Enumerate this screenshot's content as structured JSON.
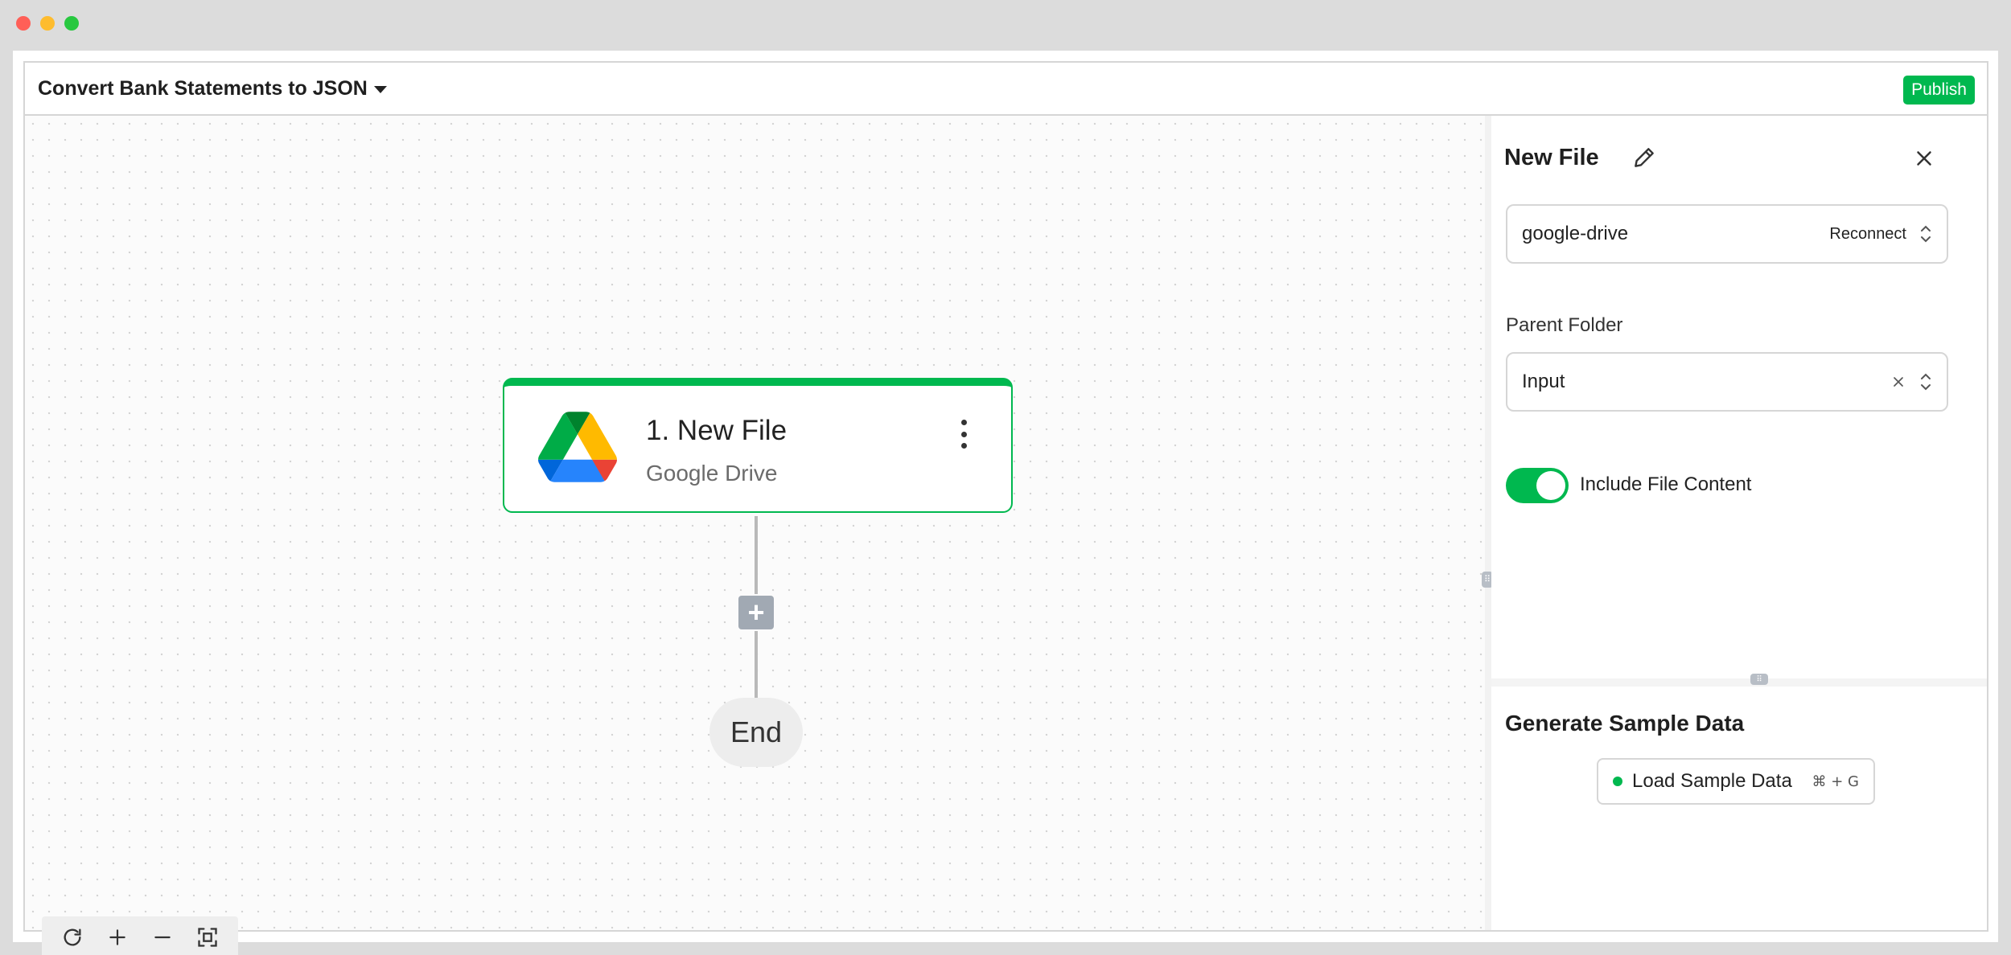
{
  "window": {
    "controls": [
      "close",
      "minimize",
      "maximize"
    ]
  },
  "header": {
    "title": "Convert Bank Statements to JSON",
    "publish_label": "Publish"
  },
  "canvas": {
    "step": {
      "title": "1. New File",
      "subtitle": "Google Drive",
      "icon": "google-drive-icon"
    },
    "add_label": "+",
    "end_label": "End",
    "controls": [
      "refresh-icon",
      "zoom-in-icon",
      "zoom-out-icon",
      "fit-view-icon"
    ]
  },
  "panel": {
    "title": "New File",
    "connection": {
      "value": "google-drive",
      "action": "Reconnect"
    },
    "parent_folder": {
      "label": "Parent Folder",
      "value": "Input"
    },
    "include_content": {
      "label": "Include File Content",
      "enabled": true
    },
    "sample": {
      "title": "Generate Sample Data",
      "button": "Load Sample Data",
      "shortcut": "⌘ + G"
    }
  },
  "colors": {
    "accent": "#00b84f",
    "node_gray": "#a1a9b3"
  }
}
